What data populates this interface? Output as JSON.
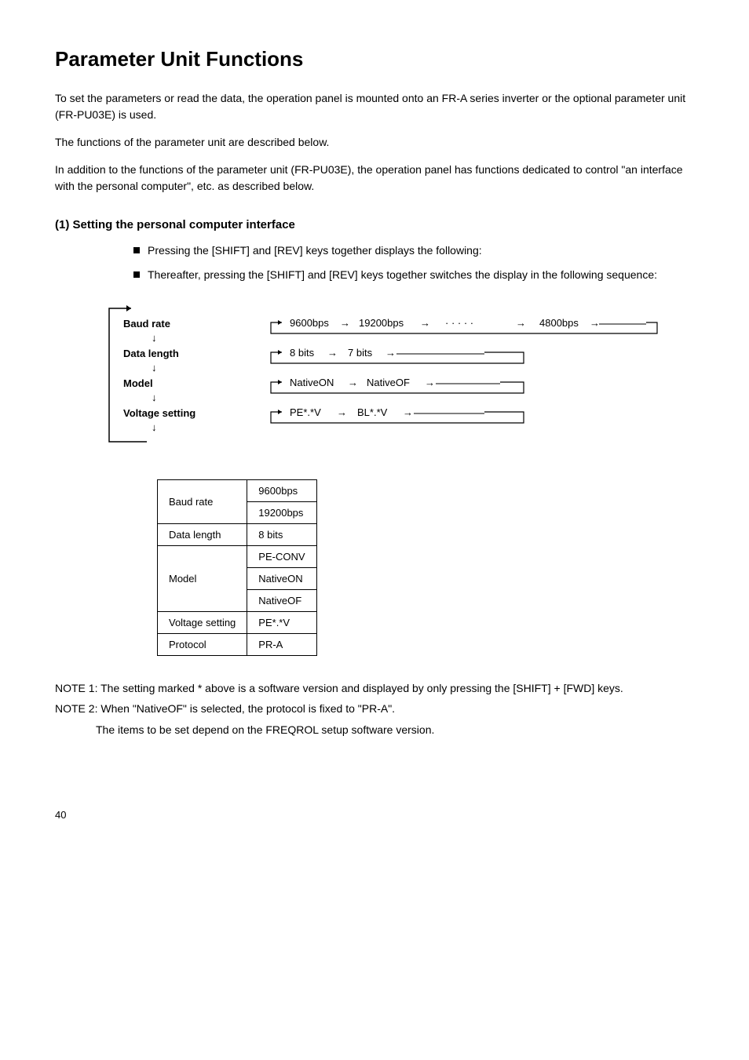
{
  "heading": "Parameter Unit Functions",
  "intro": {
    "para1": "To set the parameters or read the data, the operation panel is mounted onto an FR-A series inverter or the optional parameter unit (FR-PU03E) is used.",
    "para2": "The functions of the parameter unit are described below.",
    "para3": "In addition to the functions of the parameter unit (FR-PU03E), the operation panel has functions dedicated to control \"an interface with the personal computer\", etc. as described below."
  },
  "section_title": "(1) Setting the personal computer interface",
  "bullets": [
    "Pressing the [SHIFT] and [REV] keys together displays the following:",
    "Thereafter, pressing the [SHIFT] and [REV] keys together switches the display in the following sequence:"
  ],
  "diagram": {
    "left_labels": [
      "Baud rate",
      "Data length",
      "Model",
      "Voltage setting"
    ],
    "rows": [
      {
        "items": [
          "9600bps",
          "19200bps",
          "· · · · ·",
          "4800bps"
        ]
      },
      {
        "items": [
          "8 bits",
          "7 bits"
        ]
      },
      {
        "items": [
          "NativeON",
          "NativeOF"
        ]
      },
      {
        "items": [
          "PE*.*V",
          "BL*.*V"
        ]
      }
    ]
  },
  "table": {
    "rows": [
      {
        "c1": "Baud rate",
        "c2": "9600bps\n19200bps"
      },
      {
        "c1": "Data length",
        "c2": "8 bits"
      },
      {
        "c1": "Model",
        "c2": "PE-CONV\nNativeON\nNativeOF"
      },
      {
        "c1": "Voltage setting",
        "c2": "PE*.*V"
      },
      {
        "c1": "Protocol",
        "c2": "PR-A"
      }
    ]
  },
  "note1_label": "NOTE 1:",
  "note1_text": "The setting marked * above is a software version and displayed by only pressing the [SHIFT] + [FWD] keys.",
  "note2_label": "NOTE 2:",
  "note2_text": "When \"NativeOF\" is selected, the protocol is fixed to \"PR-A\".",
  "note3": "The items to be set depend on the FREQROL setup software version.",
  "page_num": "40"
}
